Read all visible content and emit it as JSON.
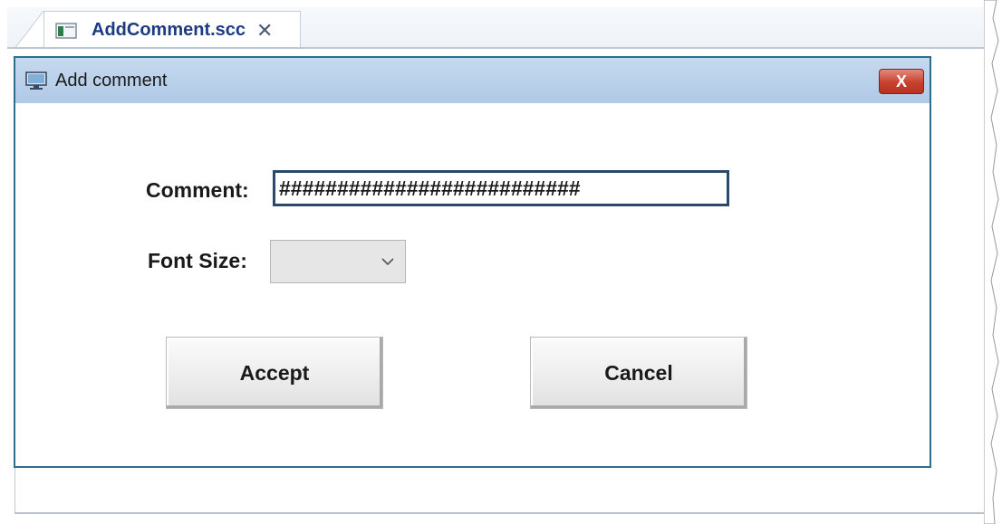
{
  "tab": {
    "title": "AddComment.scc",
    "close_glyph": "✕",
    "icon": "document-icon"
  },
  "dialog": {
    "title": "Add comment",
    "title_icon": "window-icon",
    "close_glyph": "X",
    "comment_label": "Comment:",
    "comment_value": "##########################",
    "font_size_label": "Font Size:",
    "font_size_value": "",
    "accept_label": "Accept",
    "cancel_label": "Cancel"
  },
  "colors": {
    "dialog_border": "#2d6e8a",
    "titlebar": "#b0c9e6",
    "close_button": "#c9402e",
    "tab_title": "#1d3b82"
  }
}
